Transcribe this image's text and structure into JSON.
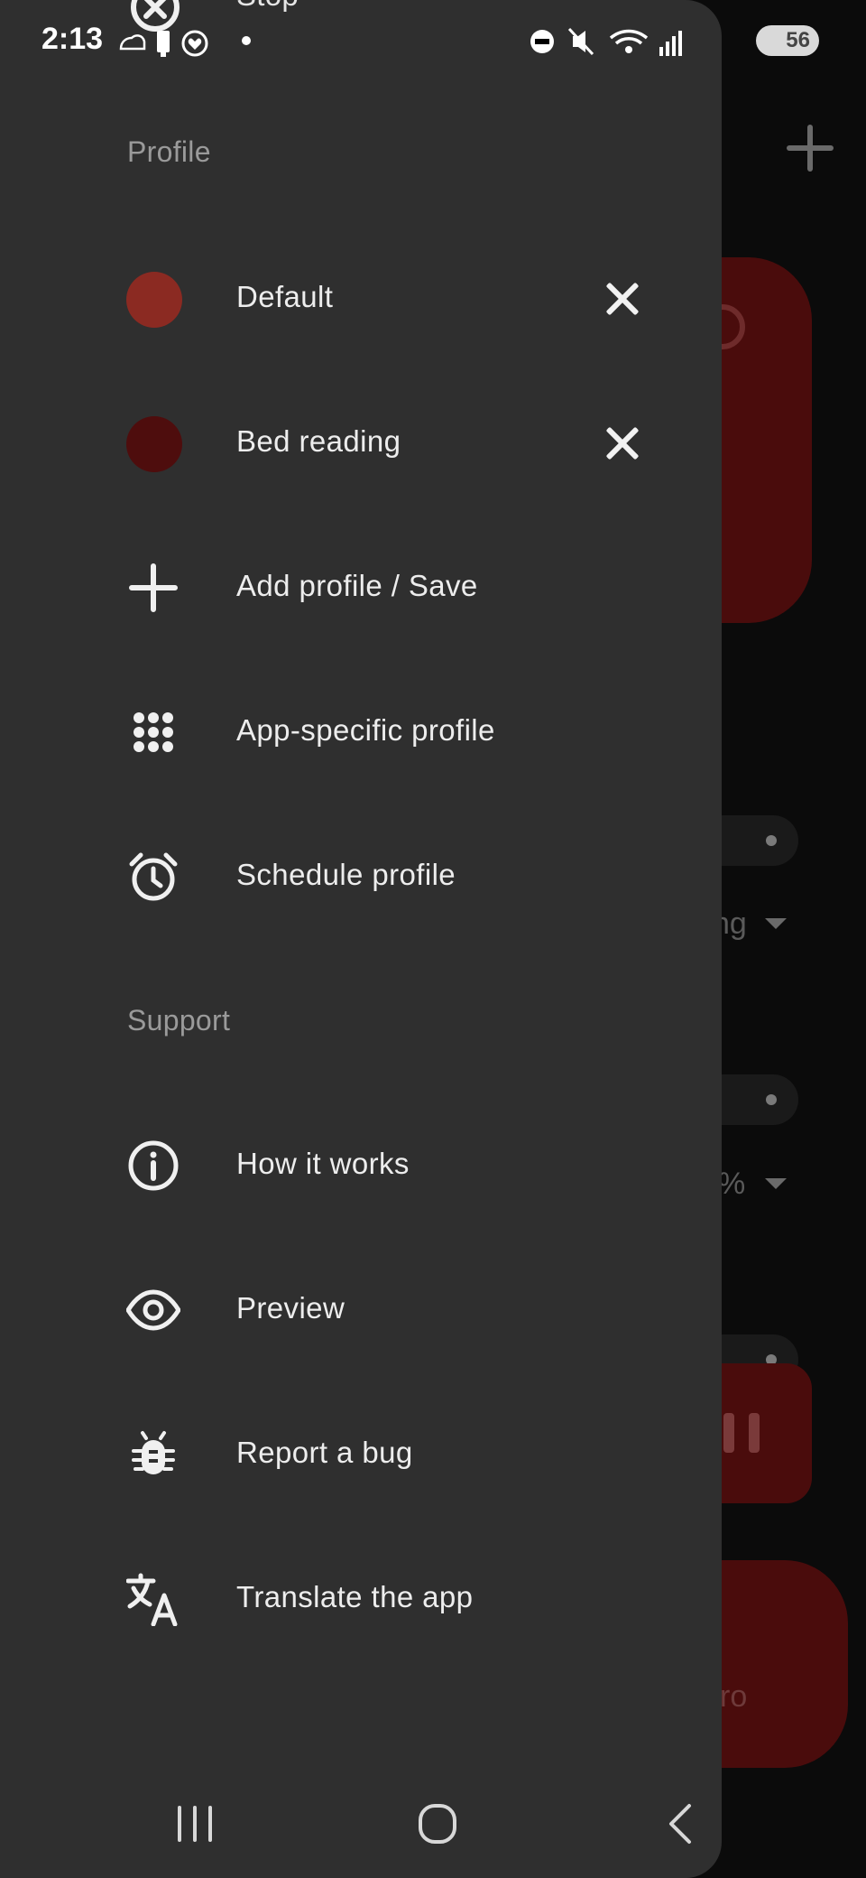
{
  "status_bar": {
    "time": "2:13",
    "battery_level": "56",
    "icons_left": [
      "cloud-icon",
      "usb-icon",
      "health-icon",
      "dot-icon"
    ],
    "icons_right": [
      "dnd-icon",
      "mute-icon",
      "wifi-icon",
      "signal-icon",
      "battery-icon"
    ]
  },
  "drawer": {
    "stop_label": "Stop",
    "profile_section": {
      "header": "Profile",
      "profiles": [
        {
          "label": "Default",
          "color": "#8b2a22"
        },
        {
          "label": "Bed reading",
          "color": "#4e0d0d"
        }
      ],
      "actions": [
        {
          "label": "Add profile / Save",
          "icon": "plus-icon"
        },
        {
          "label": "App-specific profile",
          "icon": "apps-grid-icon"
        },
        {
          "label": "Schedule profile",
          "icon": "alarm-clock-icon"
        }
      ]
    },
    "support_section": {
      "header": "Support",
      "items": [
        {
          "label": "How it works",
          "icon": "info-icon"
        },
        {
          "label": "Preview",
          "icon": "eye-icon"
        },
        {
          "label": "Report a bug",
          "icon": "bug-icon"
        },
        {
          "label": "Translate the app",
          "icon": "translate-icon"
        }
      ]
    }
  },
  "background": {
    "dropdown1_partial": "ng",
    "dropdown2_partial": "%",
    "card2_partial": "ro"
  },
  "nav_bar": {
    "buttons": [
      "recents-button",
      "home-button",
      "back-button"
    ]
  },
  "colors": {
    "drawer_bg": "#2f2f2f",
    "accent_red": "#4a0c0c",
    "text_primary": "#ededed",
    "text_secondary": "#9a9a9a"
  }
}
